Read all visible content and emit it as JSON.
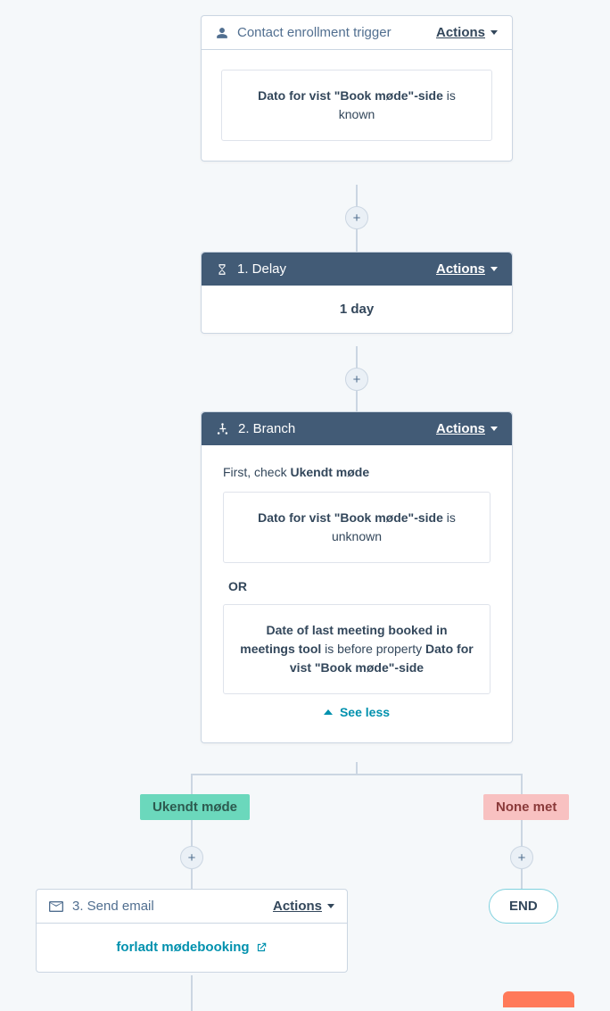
{
  "actions_label": "Actions",
  "enrollment": {
    "title": "Contact enrollment trigger",
    "criterion_strong": "Dato for vist \"Book møde\"-side",
    "criterion_suffix": " is known"
  },
  "delay": {
    "title": "1. Delay",
    "duration": "1 day"
  },
  "branch": {
    "title": "2. Branch",
    "check_prefix": "First, check ",
    "check_name": "Ukendt møde",
    "c1_strong": "Dato for vist \"Book møde\"-side",
    "c1_suffix": " is unknown",
    "or_label": "OR",
    "c2_pre_strong": "Date of last meeting booked in meetings tool",
    "c2_mid": " is before property ",
    "c2_post_strong": "Dato for vist \"Book møde\"-side",
    "see_less": "See less",
    "left_label": "Ukendt møde",
    "right_label": "None met"
  },
  "email": {
    "title": "3. Send email",
    "link": "forladt mødebooking"
  },
  "end_label": "END"
}
